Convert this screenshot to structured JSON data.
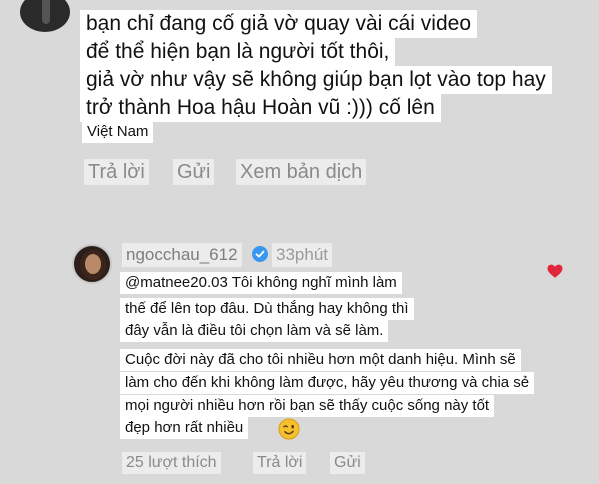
{
  "comment1": {
    "lines": [
      "bạn chỉ đang cố giả vờ quay vài cái video",
      "để thể hiện bạn là người tốt thôi,",
      "giả vờ như vậy sẽ không giúp bạn lọt vào top hay",
      "trở thành Hoa hậu Hoàn vũ :))) cố lên"
    ],
    "location": "Việt Nam",
    "actions": {
      "reply": "Trả lời",
      "send": "Gửi",
      "translate": "Xem bản dịch"
    }
  },
  "comment2": {
    "username": "ngocchau_612",
    "time": "33phút",
    "lines": [
      "@matnee20.03 Tôi không nghĩ mình làm",
      "thế để lên top đâu. Dù thắng hay không thì",
      "đây vẫn là điều tôi chọn làm và sẽ làm.",
      "Cuộc đời này đã cho tôi nhiều hơn một danh hiệu. Mình sẽ",
      "làm cho đến khi không làm được, hãy yêu thương và chia sẻ",
      "mọi người nhiều hơn rồi bạn sẽ thấy cuộc sống này tốt",
      "đẹp hơn rất nhiều"
    ],
    "actions": {
      "likes": "25 lượt thích",
      "reply": "Trả lời",
      "send": "Gửi"
    }
  },
  "icons": {
    "verified": "verified-badge-icon",
    "heart": "heart-icon",
    "wink": "wink-emoji-icon",
    "heart_color": "#e0283c",
    "verified_color": "#3897f0"
  }
}
